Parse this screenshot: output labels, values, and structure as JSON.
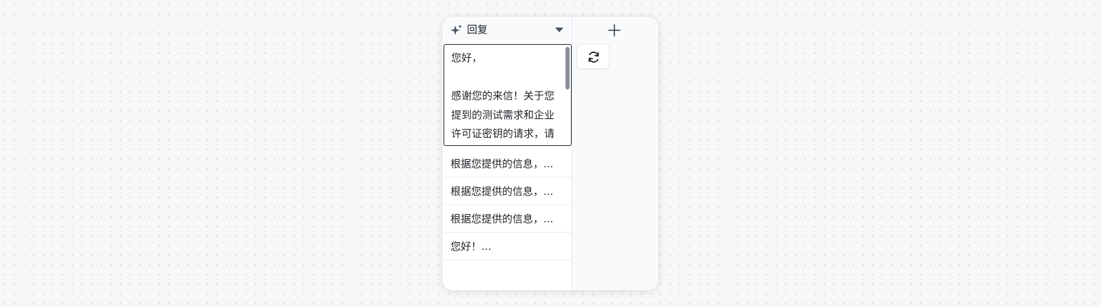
{
  "column": {
    "icon": "sparkle-icon",
    "title": "回复",
    "dropdown_icon": "caret-down-icon",
    "editor": {
      "text": "您好，\n\n感谢您的来信！关于您提到的测试需求和企业许可证密钥的请求，请"
    },
    "rows": [
      {
        "text": "根据您提供的信息，..."
      },
      {
        "text": "根据您提供的信息，..."
      },
      {
        "text": "根据您提供的信息，..."
      },
      {
        "text": "您好！..."
      }
    ]
  },
  "add_column": {
    "icon": "plus-icon",
    "refresh_icon": "refresh-icon"
  },
  "colors": {
    "background": "#f7f7f8",
    "card": "#f8fafc",
    "text": "#1f2328",
    "border": "#e3e8ef",
    "editor_border": "#1f2328"
  }
}
